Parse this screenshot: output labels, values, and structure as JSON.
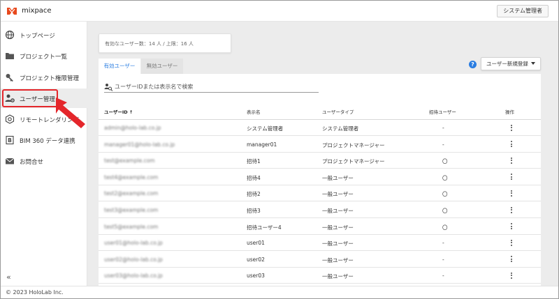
{
  "app": {
    "title": "mixpace",
    "admin_button": "システム管理者"
  },
  "sidebar": {
    "items": [
      {
        "label": "トップページ",
        "icon": "globe-icon"
      },
      {
        "label": "プロジェクト一覧",
        "icon": "folder-icon"
      },
      {
        "label": "プロジェクト権限管理",
        "icon": "key-icon"
      },
      {
        "label": "ユーザー管理",
        "icon": "user-gear-icon",
        "active": true
      },
      {
        "label": "リモートレンダリング",
        "icon": "hexagon-gear-icon"
      },
      {
        "label": "BIM 360 データ連携",
        "icon": "b-box-icon"
      },
      {
        "label": "お問合せ",
        "icon": "mail-icon"
      }
    ],
    "collapse_label": "«"
  },
  "stats": {
    "text": "有効なユーザー数：14 人 / 上限：16 人"
  },
  "tabs": [
    {
      "label": "有効ユーザー",
      "active": true
    },
    {
      "label": "無効ユーザー",
      "active": false
    }
  ],
  "toolbar": {
    "help": "?",
    "register_label": "ユーザー新規登録"
  },
  "search": {
    "placeholder": "ユーザーIDまたは表示名で検索"
  },
  "table": {
    "headers": {
      "user_id": "ユーザーID ↑",
      "display_name": "表示名",
      "user_type": "ユーザータイプ",
      "invited": "招待ユーザー",
      "actions": "操作"
    },
    "rows": [
      {
        "user_id": "admin@holo-lab.co.jp",
        "display_name": "システム管理者",
        "user_type": "システム管理者",
        "invited": "-"
      },
      {
        "user_id": "manager01@holo-lab.co.jp",
        "display_name": "manager01",
        "user_type": "プロジェクトマネージャー",
        "invited": "-"
      },
      {
        "user_id": "test@example.com",
        "display_name": "招待1",
        "user_type": "プロジェクトマネージャー",
        "invited": "〇"
      },
      {
        "user_id": "test4@example.com",
        "display_name": "招待4",
        "user_type": "一般ユーザー",
        "invited": "〇"
      },
      {
        "user_id": "test2@example.com",
        "display_name": "招待2",
        "user_type": "一般ユーザー",
        "invited": "〇"
      },
      {
        "user_id": "test3@example.com",
        "display_name": "招待3",
        "user_type": "一般ユーザー",
        "invited": "〇"
      },
      {
        "user_id": "test5@example.com",
        "display_name": "招待ユーザー4",
        "user_type": "一般ユーザー",
        "invited": "〇"
      },
      {
        "user_id": "user01@holo-lab.co.jp",
        "display_name": "user01",
        "user_type": "一般ユーザー",
        "invited": "-"
      },
      {
        "user_id": "user02@holo-lab.co.jp",
        "display_name": "user02",
        "user_type": "一般ユーザー",
        "invited": "-"
      },
      {
        "user_id": "user03@holo-lab.co.jp",
        "display_name": "user03",
        "user_type": "一般ユーザー",
        "invited": "-"
      }
    ]
  },
  "footer": {
    "copyright": "© 2023 HoloLab Inc."
  },
  "colors": {
    "accent": "#2a7de1",
    "highlight": "#e4262b",
    "logo": "#e8491d"
  }
}
